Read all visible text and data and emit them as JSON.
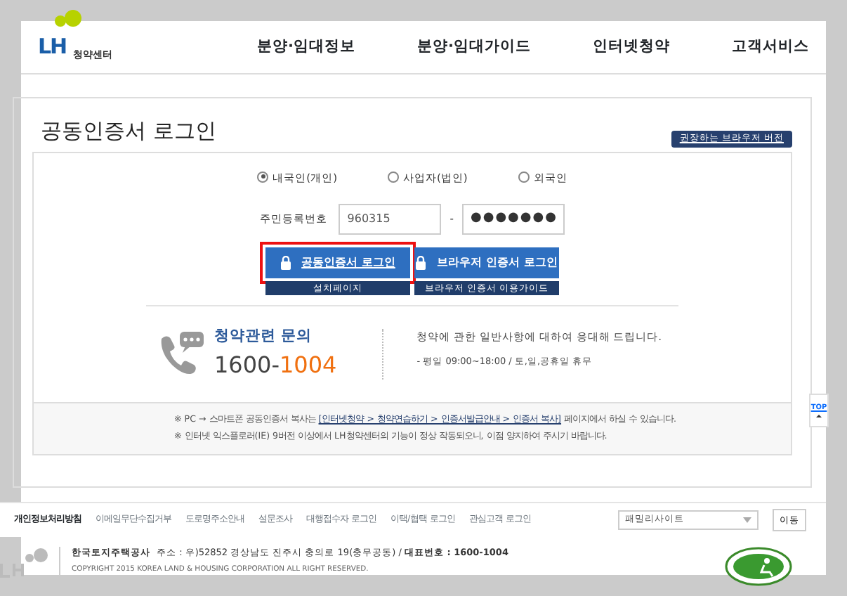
{
  "header": {
    "logo_text": "LH",
    "logo_sub": "청약센터",
    "nav": [
      "분양·임대정보",
      "분양·임대가이드",
      "인터넷청약",
      "고객서비스"
    ]
  },
  "page": {
    "title": "공동인증서 로그인",
    "browser_badge": "권장하는 브라우저 버전"
  },
  "login": {
    "types": [
      {
        "label": "내국인(개인)",
        "selected": true
      },
      {
        "label": "사업자(법인)",
        "selected": false
      },
      {
        "label": "외국인",
        "selected": false
      }
    ],
    "id_label": "주민등록번호",
    "id_front": "960315",
    "separator": "-",
    "id_back": "●●●●●●●",
    "buttons": [
      {
        "label": "공동인증서 로그인",
        "sub": "설치페이지",
        "highlighted": true
      },
      {
        "label": "브라우저 인증서 로그인",
        "sub": "브라우저 인증서 이용가이드",
        "highlighted": false
      }
    ]
  },
  "contact": {
    "title": "청약관련 문의",
    "number_prefix": "1600-",
    "number_suffix": "1004",
    "desc": "청약에 관한 일반사항에 대하여 응대해 드립니다.",
    "hours": "- 평일 09:00~18:00  /  토,일,공휴일 휴무"
  },
  "notes": [
    {
      "before": "※ PC → 스마트폰 공동인증서 복사는 ",
      "link": "[인터넷청약 > 청약연습하기 > 인증서발급안내 > 인증서 복사]",
      "after": " 페이지에서 하실 수 있습니다."
    },
    {
      "before": "※ 인터넷 익스플로러(IE) 9버전 이상에서 LH청약센터의 기능이 정상 작동되오니, 이점 양지하여 주시기 바랍니다."
    }
  ],
  "top_button": "TOP",
  "footer": {
    "links": [
      {
        "label": "개인정보처리방침",
        "bold": true
      },
      {
        "label": "이메일무단수집거부",
        "bold": false
      },
      {
        "label": "도로명주소안내",
        "bold": false
      },
      {
        "label": "설문조사",
        "bold": false
      },
      {
        "label": "대행접수자 로그인",
        "bold": false
      },
      {
        "label": "이택/협택 로그인",
        "bold": false
      },
      {
        "label": "관심고객 로그인",
        "bold": false
      }
    ],
    "family_select": "패밀리사이트",
    "go_button": "이동",
    "company": "한국토지주택공사",
    "address": "주소 : 우)52852 경상남도 진주시 충의로 19(충무공동)  /  ",
    "phone_label": "대표번호 : 1600-1004",
    "copyright": "COPYRIGHT 2015 KOREA LAND & HOUSING CORPORATION ALL RIGHT RESERVED."
  }
}
